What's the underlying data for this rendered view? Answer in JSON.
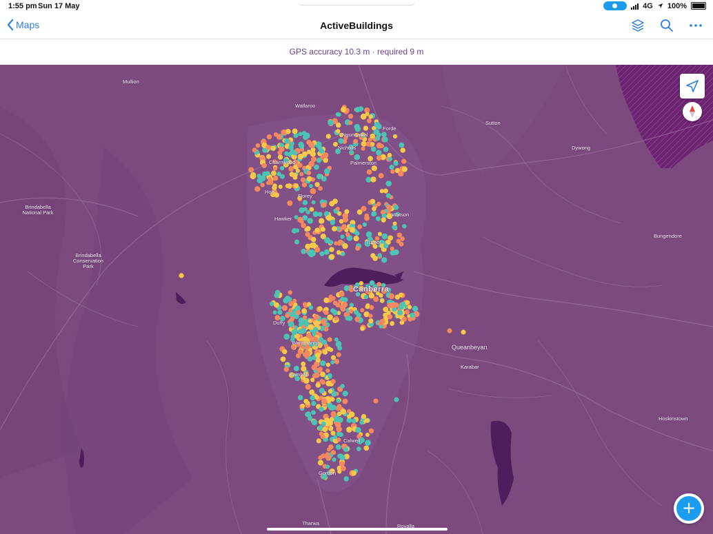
{
  "status": {
    "time": "1:55 pm",
    "date": "Sun 17 May",
    "network": "4G",
    "battery": "100%"
  },
  "nav": {
    "back_label": "Maps",
    "title": "ActiveBuildings"
  },
  "gps": {
    "text": "GPS accuracy 10.3 m · required 9 m"
  },
  "colors": {
    "map": "#7c4a7f",
    "accent": "#1c9cf0",
    "dot_orange": "#f4895f",
    "dot_yellow": "#f6c94b",
    "dot_teal": "#4cc3b4"
  },
  "icons": [
    "chevron-left-icon",
    "layers-icon",
    "search-icon",
    "more-icon",
    "location-arrow-icon",
    "compass-icon",
    "plus-icon"
  ],
  "map_labels": [
    {
      "name": "Mullion",
      "size": "small"
    },
    {
      "name": "Wallaroo",
      "size": "small"
    },
    {
      "name": "Sutton",
      "size": "small"
    },
    {
      "name": "Dywong",
      "size": "small"
    },
    {
      "name": "Brindabella National Park",
      "size": "small"
    },
    {
      "name": "Brindabella Conservation Park",
      "size": "small"
    },
    {
      "name": "Bungendore",
      "size": "small"
    },
    {
      "name": "Ngunnawal",
      "size": "small"
    },
    {
      "name": "Forde",
      "size": "small"
    },
    {
      "name": "Nicholls",
      "size": "small"
    },
    {
      "name": "Palmerston",
      "size": "small"
    },
    {
      "name": "Charnwood",
      "size": "small"
    },
    {
      "name": "Holt",
      "size": "small"
    },
    {
      "name": "Florey",
      "size": "small"
    },
    {
      "name": "Hawker",
      "size": "small"
    },
    {
      "name": "Watson",
      "size": "small"
    },
    {
      "name": "Turner",
      "size": "small"
    },
    {
      "name": "Canberra",
      "size": "big"
    },
    {
      "name": "Duffy",
      "size": "small"
    },
    {
      "name": "Waramanga",
      "size": "small"
    },
    {
      "name": "Queanbeyan",
      "size": "mid"
    },
    {
      "name": "Karabar",
      "size": "small"
    },
    {
      "name": "Kambah",
      "size": "small"
    },
    {
      "name": "Hoskinstown",
      "size": "small"
    },
    {
      "name": "Calwell",
      "size": "small"
    },
    {
      "name": "Gordon",
      "size": "small"
    },
    {
      "name": "Tharwa",
      "size": "small"
    },
    {
      "name": "Royalla",
      "size": "small"
    }
  ]
}
